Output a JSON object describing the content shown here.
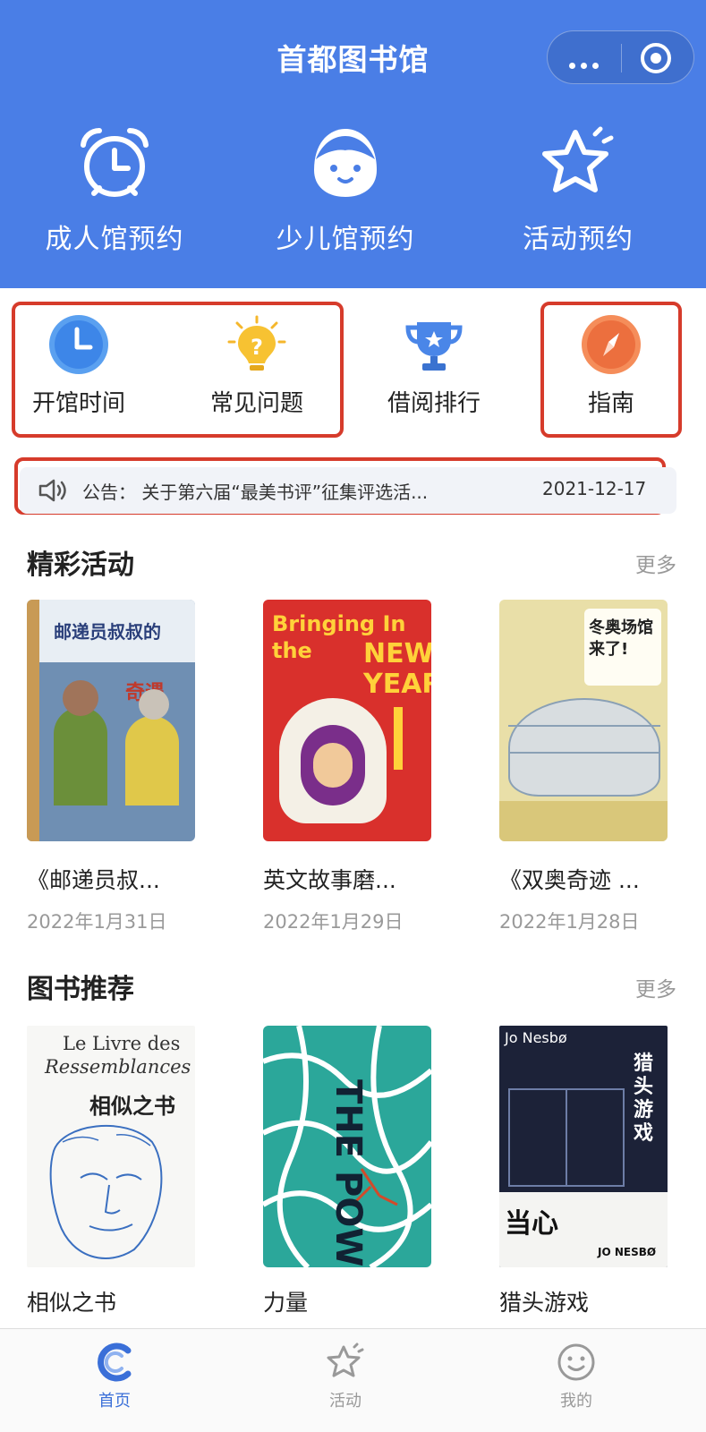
{
  "header": {
    "title": "首都图书馆",
    "entries": [
      {
        "label": "成人馆预约",
        "icon": "alarm-clock-icon"
      },
      {
        "label": "少儿馆预约",
        "icon": "child-face-icon"
      },
      {
        "label": "活动预约",
        "icon": "star-icon"
      }
    ]
  },
  "quick_menu": [
    {
      "label": "开馆时间",
      "icon": "clock-icon"
    },
    {
      "label": "常见问题",
      "icon": "lightbulb-question-icon"
    },
    {
      "label": "借阅排行",
      "icon": "trophy-icon"
    },
    {
      "label": "指南",
      "icon": "compass-icon"
    }
  ],
  "notice": {
    "text": "公告：  关于第六届“最美书评”征集评选活...",
    "date": "2021-12-17"
  },
  "activities": {
    "title": "精彩活动",
    "more": "更多",
    "items": [
      {
        "title": "《邮递员叔...",
        "date": "2022年1月31日",
        "cover_text": "邮递员叔叔的 奇遇"
      },
      {
        "title": "英文故事磨...",
        "date": "2022年1月29日",
        "cover_text": "Bringing In the NEW YEAR"
      },
      {
        "title": "《双奥奇迹 ...",
        "date": "2022年1月28日",
        "cover_text": "冬奥场馆来了!"
      }
    ]
  },
  "books": {
    "title": "图书推荐",
    "more": "更多",
    "items": [
      {
        "title": "相似之书",
        "cover_text": "Le Livre des Ressemblances 相似之书"
      },
      {
        "title": "力量",
        "cover_text": "THE POWER"
      },
      {
        "title": "猎头游戏",
        "cover_text": "猎头游戏 Jo Nesbø"
      }
    ]
  },
  "tabbar": [
    {
      "label": "首页",
      "active": true
    },
    {
      "label": "活动",
      "active": false
    },
    {
      "label": "我的",
      "active": false
    }
  ],
  "colors": {
    "primary": "#4a7ee6",
    "highlight_box": "#d63b2b",
    "active_tab": "#3a6fd8"
  }
}
